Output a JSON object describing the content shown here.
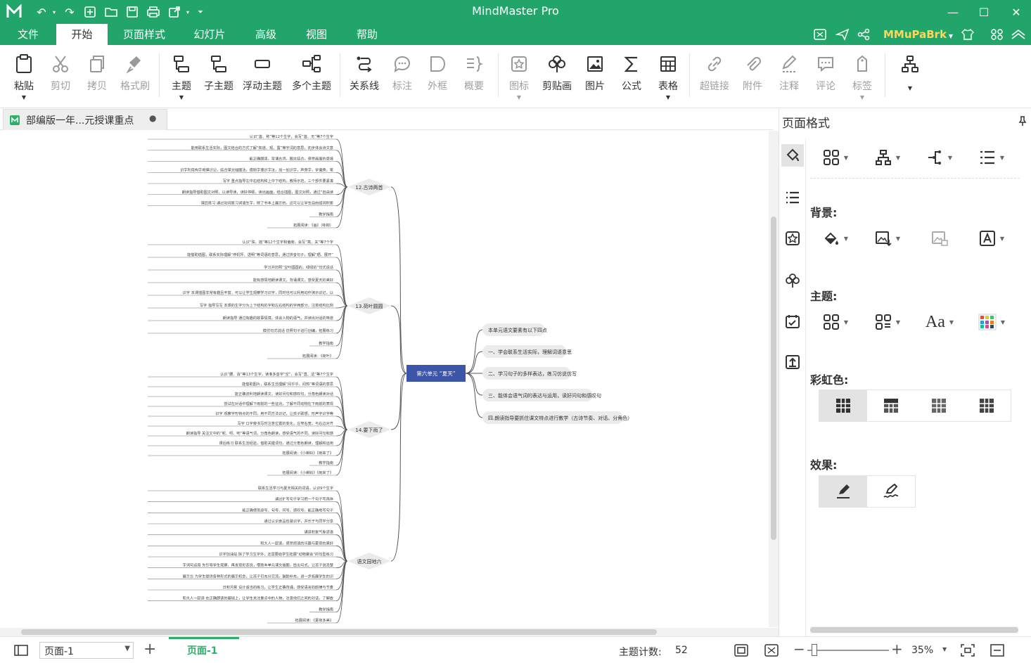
{
  "app": {
    "title": "MindMaster Pro",
    "user": "MMuPaBrk"
  },
  "menu": [
    "文件",
    "开始",
    "页面样式",
    "幻灯片",
    "高级",
    "视图",
    "帮助"
  ],
  "toolbar": {
    "paste": "粘贴",
    "cut": "剪切",
    "copy": "拷贝",
    "format_brush": "格式刷",
    "topic": "主题",
    "subtopic": "子主题",
    "floating_topic": "浮动主题",
    "multi_topic": "多个主题",
    "relationship": "关系线",
    "callout": "标注",
    "boundary": "外框",
    "summary": "概要",
    "icon": "图标",
    "clipart": "剪贴画",
    "picture": "图片",
    "formula": "公式",
    "table": "表格",
    "hyperlink": "超链接",
    "attachment": "附件",
    "note": "注释",
    "comment": "评论",
    "tag": "标签"
  },
  "doc_tab": {
    "title": "部编版一年...元授课重点"
  },
  "panel": {
    "title": "页面格式",
    "background": "背景:",
    "theme": "主题:",
    "rainbow": "彩虹色:",
    "effect": "效果:"
  },
  "status": {
    "page_select": "页面-1",
    "page_tab": "页面-1",
    "topic_count_label": "主题计数:",
    "topic_count": "52",
    "zoom": "35%"
  },
  "mindmap": {
    "central": "第六单元 “夏天”",
    "right_branches": [
      "本单元语文要素有以下四点",
      "一、学会联系生活实际，理解词语意思",
      "二、学习句子的多样表达，练习仿说仿写",
      "三、能体会语气词的表达与运用，读好问句和感叹句",
      "四.朗读指导要抓住课文特点进行教学（古诗节奏、对话、分角色）"
    ],
    "left_branches": [
      {
        "title": "12.古诗两首",
        "items": [
          "认识“首、称”等12个生字，会写“首、无”等7个生字",
          "能用联系生活实际，图文结合的方式了解“知道、观、露”等字词的意思，初步体会诗文意",
          "能正确朗读，背诵古诗，图文结合，感受画面的意境",
          "识字利用构字规律识记，结合课文插图法，借助字理识字法，加一加识字，声旁字，学偏旁，笔顺",
          "写字 重点指导左中右结构和上中下结构，教师示范，三个部件要紧凑",
          "朗读指导借助图文对照，以读导读，读好停顿，读出画面，结合插图，图文对照，通过“自由读、分组读”等多种形式的朗读背诵古诗",
          "课后练习 通过动词复习词语生字，除了书本上展示的，还可以让学生自由组词积累"
        ],
        "method": "教学指南",
        "expand": "拓展阅读：《画》（咏柳）"
      },
      {
        "title": "13.荷叶圆圆",
        "items": [
          "认识“珠、摇”等12个生字和偏旁，会写“亮、关”等7个字",
          "能借助插图，联系实际理解“停机坪、透明”等词语的意思，通过拼音句子，理解“晒、展开”等词语的意思",
          "学习并仿照“宝叶圆圆的，绿绿的”句式说话",
          "能有感情地朗读课文，背诵课文，感受夏天的美好",
          "识字 本课插图非常有趣且丰富，可以让学生观察学习识字，同时也可以利用动作演示识记，以学代讲的形式让孩子认识更多，认识新偏旁“雨”，告诉孩子与雨水有关",
          "写字 指导写写 本课的生字分为上下结构的字和左右结构的字两部分，注意结构比例",
          "朗读指导 通过有趣的故事情境，体会人物的语气，并读出对话的味道",
          "模仿句式说话 仿照句子进行创编，拓展练习"
        ],
        "method": "教学指南",
        "expand": "拓展阅读：《荷叶》"
      },
      {
        "title": "14.要下雨了",
        "items": [
          "认识“腰、消”等13个生字，读准多音字“空”，会写“直、这”等7个生字",
          "能借助图片，联系生活理解“闷乎乎、闷热”等词语的意思",
          "能正确流利地朗读课文，读好问句和感叹句，分角色朗读对话",
          "尝试在对话中理解下雨前的一些征兆，了解不同动物在下雨前的表现",
          "识字 观察字形特点的不同，用不同方法识记，让孩子联想，形声字识字等",
          "写字 口字旁书写时注意位置的变化，左窄右宽，与右边对齐",
          "朗读指导 关注文中的“呢、呀、吧”等语气词，分角色朗读，感受语气的不同，读好问句和感叹句",
          "课后练习 联系生活经验，借助关键词句，通过分角色朗读，理解和运用",
          "拓展阅读：《小蝌蚪》《雨来了》"
        ],
        "method": "教学指南",
        "expand": "拓展阅读：《小蝌蚪》《雨来了》"
      },
      {
        "title": "语文园地六",
        "items": [
          "联系生活学习与夏天相关的词语，认识9个生字",
          "通过扩写句子学习把一个句子写具体",
          "能正确使用逗号、句号、问号、感叹号，能正确地写句子",
          "通过认识食品包装识字，并乐于与同学分享",
          "诵读积累气象谚语",
          "和大人一起读，感受阅读的乐趣与夏夜的美好",
          "识字加油站 除了学习生字外，还需要给学生拓展“动物聚会”的句型练习",
          "字词句运用 先引导学生观察，再发现形态说，借助本单元课文插图，给出句式，让孩子说清楚，具体",
          "展示台 为学生提供各种形式的展示机会，让孩子们充分交流，鼓励补充，进一步拓展学生的识字途径",
          "日积月累 设计适当的练习，让学生正确背诵，感受语言的韵律与节奏",
          "和大人一起读 在正确朗读的基础上，让学生关注重点中的人物，注意他们之间的对话，了解故事内容，同时，让孩子和家长或老师一起讲述一起表演"
        ],
        "method": "教学指南",
        "expand": "拓展阅读：《夏夜多美》"
      }
    ]
  }
}
